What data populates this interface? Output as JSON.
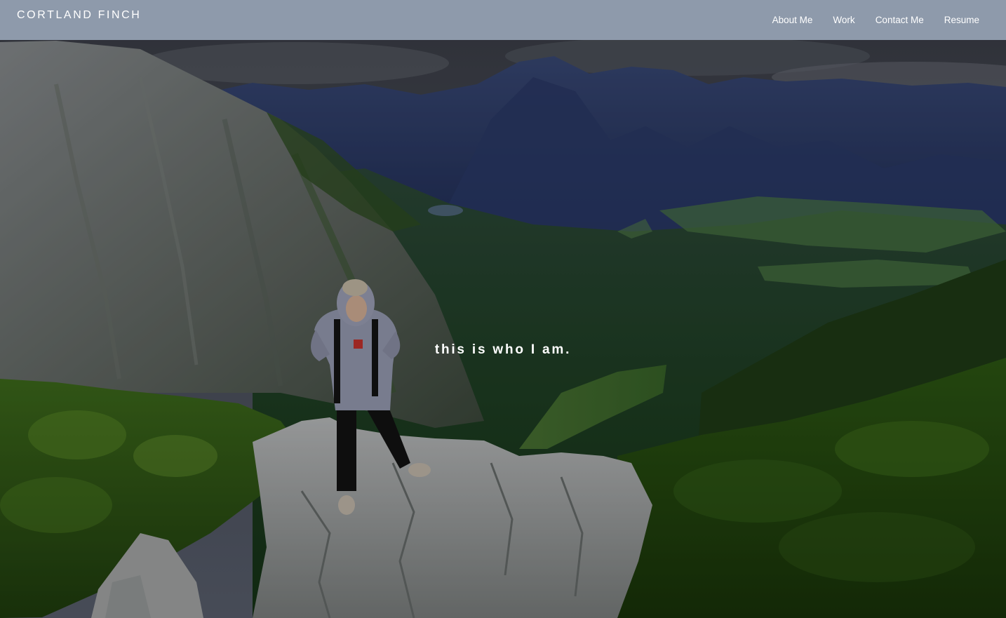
{
  "header": {
    "brand": "CORTLAND FINCH",
    "nav": [
      {
        "label": "About Me"
      },
      {
        "label": "Work"
      },
      {
        "label": "Contact Me"
      },
      {
        "label": "Resume"
      }
    ]
  },
  "hero": {
    "tagline": "this is who I am."
  },
  "colors": {
    "header_bg": "#8e9aab",
    "header_text": "#ffffff",
    "tagline_text": "#ffffff"
  }
}
